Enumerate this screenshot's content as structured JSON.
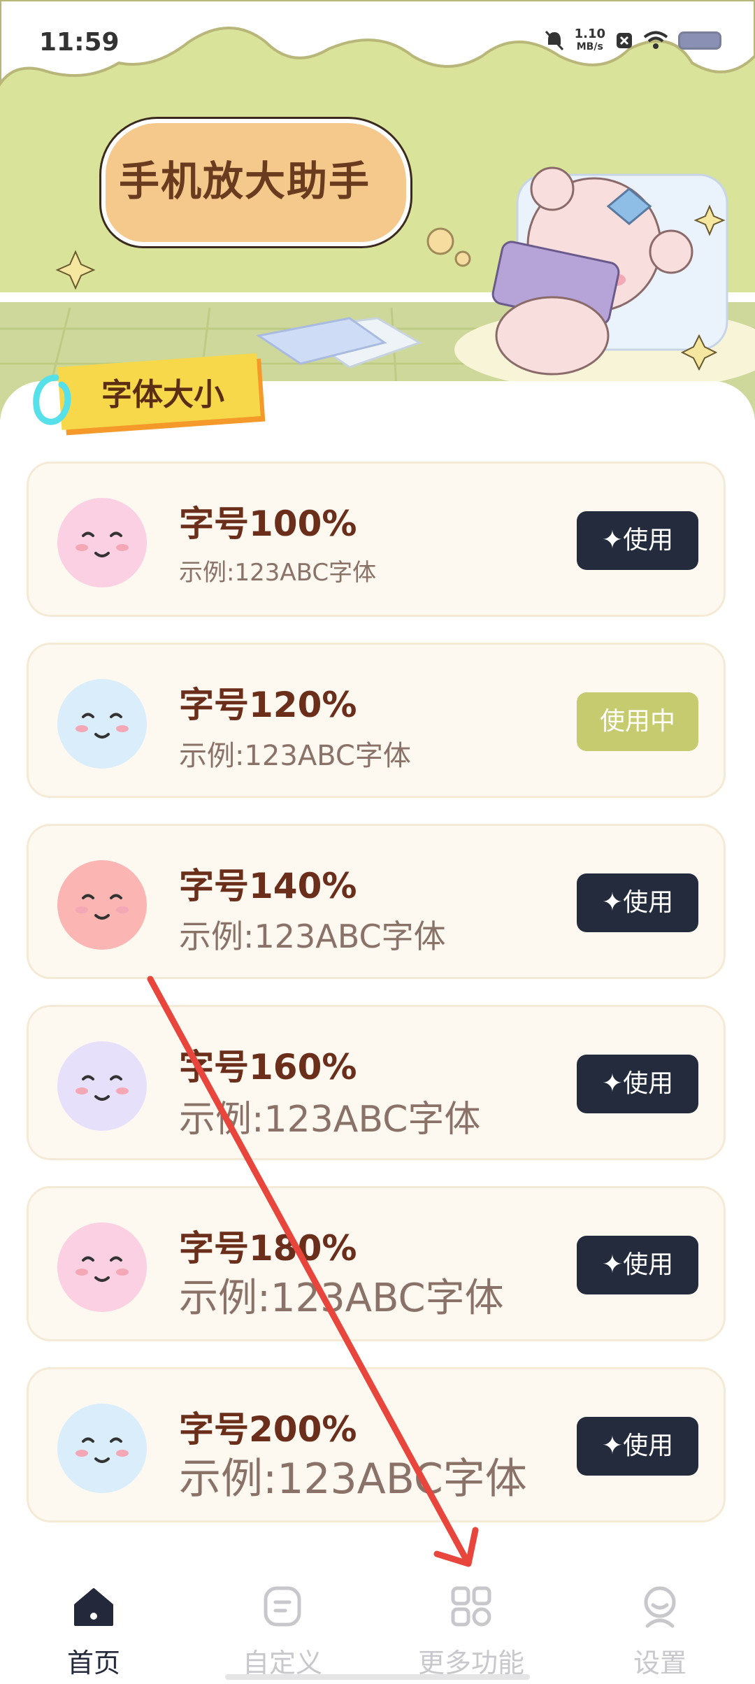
{
  "status_bar": {
    "time": "11:59",
    "net_speed_value": "1.10",
    "net_speed_unit": "MB/s"
  },
  "header": {
    "title": "手机放大助手",
    "section": "字体大小"
  },
  "font_options": [
    {
      "label": "字号100%",
      "sample": "示例:123ABC字体",
      "button": "✦使用",
      "active": false,
      "avatar_color": "#fbd0e2"
    },
    {
      "label": "字号120%",
      "sample": "示例:123ABC字体",
      "button": "使用中",
      "active": true,
      "avatar_color": "#d9edfb"
    },
    {
      "label": "字号140%",
      "sample": "示例:123ABC字体",
      "button": "✦使用",
      "active": false,
      "avatar_color": "#fbb5b2"
    },
    {
      "label": "字号160%",
      "sample": "示例:123ABC字体",
      "button": "✦使用",
      "active": false,
      "avatar_color": "#e7e0fb"
    },
    {
      "label": "字号180%",
      "sample": "示例:123ABC字体",
      "button": "✦使用",
      "active": false,
      "avatar_color": "#fbd0e2"
    },
    {
      "label": "字号200%",
      "sample": "示例:123ABC字体",
      "button": "✦使用",
      "active": false,
      "avatar_color": "#d9edfb"
    }
  ],
  "bottom_nav": [
    {
      "label": "首页",
      "icon": "home-icon",
      "active": true
    },
    {
      "label": "自定义",
      "icon": "customize-icon",
      "active": false
    },
    {
      "label": "更多功能",
      "icon": "grid-icon",
      "active": false
    },
    {
      "label": "设置",
      "icon": "profile-icon",
      "active": false
    }
  ],
  "colors": {
    "banner_green": "#d9e49a",
    "button_dark": "#232b3c",
    "button_active": "#c5cb6e",
    "title_brown": "#6a2e1a",
    "annotation_arrow": "#e8463c"
  }
}
